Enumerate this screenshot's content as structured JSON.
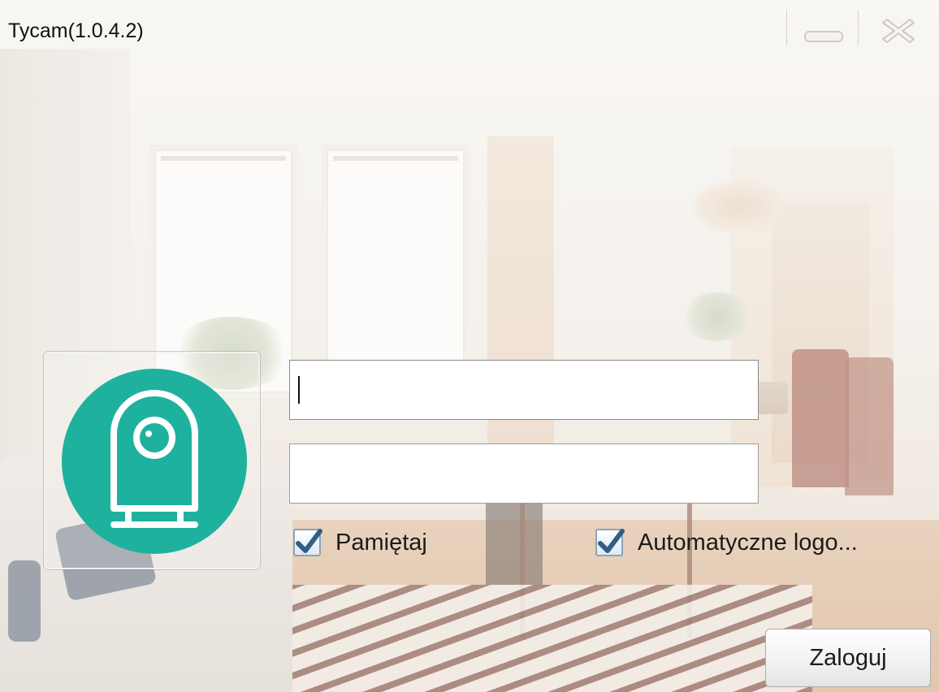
{
  "window": {
    "title": "Tycam(1.0.4.2)",
    "controls": {
      "minimize_icon": "minimize-icon",
      "close_icon": "close-icon"
    }
  },
  "logo": {
    "icon": "camera-icon",
    "background_color": "#1eb29e"
  },
  "login_form": {
    "username": {
      "value": "",
      "placeholder": ""
    },
    "password": {
      "value": "",
      "placeholder": ""
    },
    "remember": {
      "label": "Pamiętaj",
      "checked": true
    },
    "auto_login": {
      "label": "Automatyczne logo...",
      "checked": true
    },
    "submit_label": "Zaloguj"
  }
}
